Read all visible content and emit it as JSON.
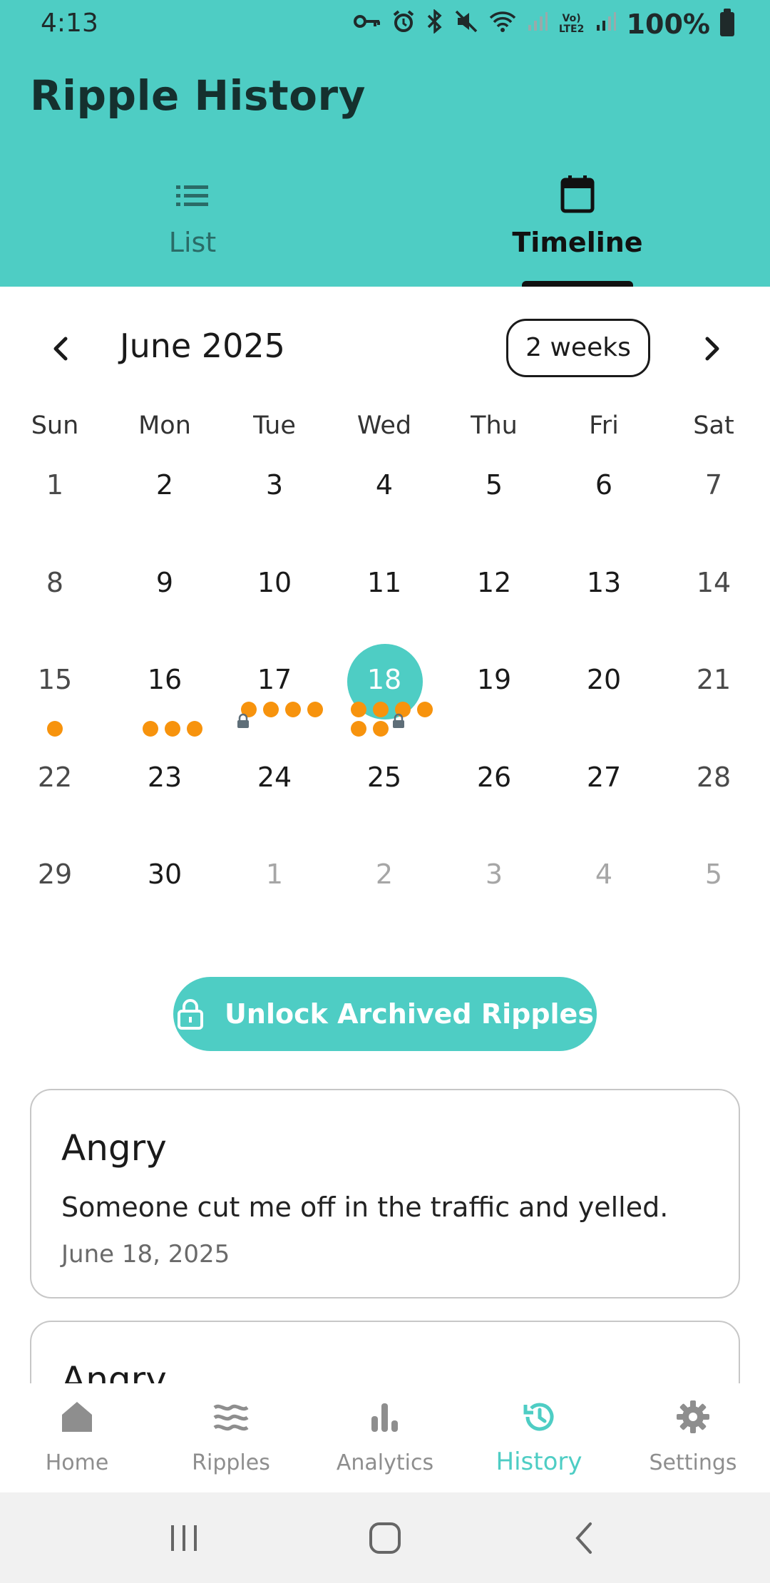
{
  "status_bar": {
    "time": "4:13",
    "signal_label": "Vo) LTE2",
    "battery": "100%"
  },
  "header": {
    "title": "Ripple History"
  },
  "tabs": [
    {
      "label": "List",
      "icon": "list-icon",
      "active": false
    },
    {
      "label": "Timeline",
      "icon": "calendar-icon",
      "active": true
    }
  ],
  "calendar": {
    "month_label": "June 2025",
    "range_button": "2 weeks",
    "weekdays": [
      "Sun",
      "Mon",
      "Tue",
      "Wed",
      "Thu",
      "Fri",
      "Sat"
    ],
    "weeks": [
      [
        "1",
        "2",
        "3",
        "4",
        "5",
        "6",
        "7"
      ],
      [
        "8",
        "9",
        "10",
        "11",
        "12",
        "13",
        "14"
      ],
      [
        "15",
        "16",
        "17",
        "18",
        "19",
        "20",
        "21"
      ],
      [
        "22",
        "23",
        "24",
        "25",
        "26",
        "27",
        "28"
      ],
      [
        "29",
        "30",
        "1",
        "2",
        "3",
        "4",
        "5"
      ]
    ],
    "selected_day": "18",
    "ripple_markers": [
      {
        "day": "15",
        "ripples": 1,
        "locked": false
      },
      {
        "day": "16",
        "ripples": 3,
        "locked": false
      },
      {
        "day": "17",
        "ripples": 4,
        "locked": true
      },
      {
        "day": "18",
        "ripples": 6,
        "locked": true
      }
    ],
    "accent_color": "#4ECDC4",
    "ripple_color": "#F7930D"
  },
  "unlock_button": {
    "label": "Unlock Archived Ripples",
    "icon": "lock-icon"
  },
  "entries": [
    {
      "title": "Angry",
      "text": "Someone cut me off in the traffic and yelled.",
      "date": "June 18, 2025"
    },
    {
      "title": "Angry"
    }
  ],
  "bottom_nav": [
    {
      "label": "Home",
      "icon": "home-icon",
      "active": false
    },
    {
      "label": "Ripples",
      "icon": "waves-icon",
      "active": false
    },
    {
      "label": "Analytics",
      "icon": "bar-chart-icon",
      "active": false
    },
    {
      "label": "History",
      "icon": "history-icon",
      "active": true
    },
    {
      "label": "Settings",
      "icon": "gear-icon",
      "active": false
    }
  ],
  "system_nav": [
    {
      "icon": "recents-icon"
    },
    {
      "icon": "home-circle-icon"
    },
    {
      "icon": "back-icon"
    }
  ]
}
